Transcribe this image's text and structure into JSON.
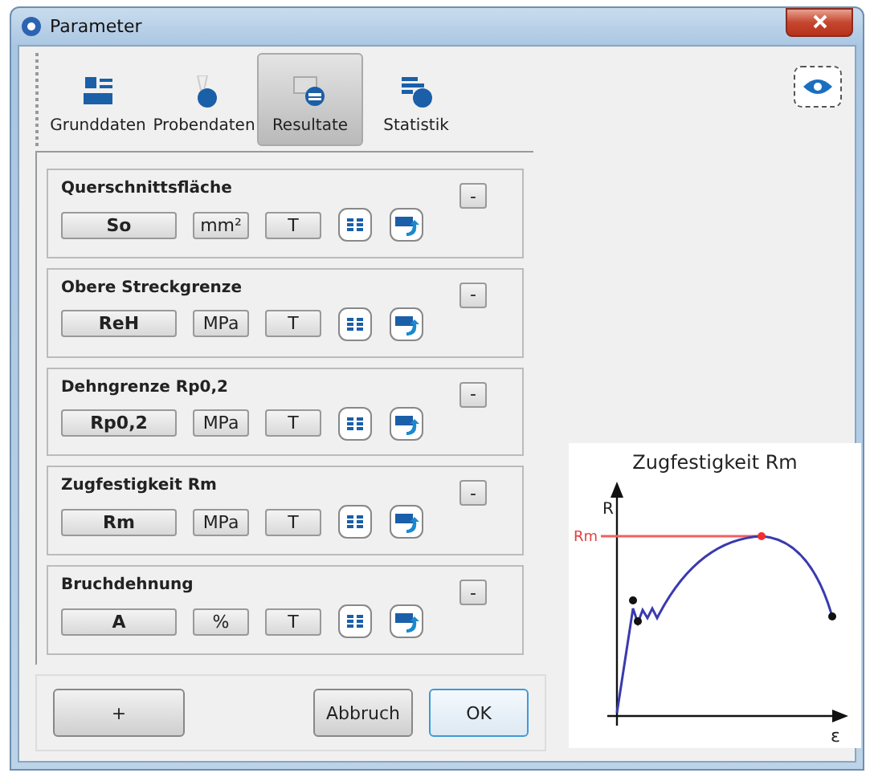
{
  "window": {
    "title": "Parameter"
  },
  "tabs": [
    {
      "label": "Grunddaten",
      "selected": false
    },
    {
      "label": "Probendaten",
      "selected": false
    },
    {
      "label": "Resultate",
      "selected": true
    },
    {
      "label": "Statistik",
      "selected": false
    }
  ],
  "groups": [
    {
      "title": "Querschnittsfläche",
      "symbol": "So",
      "unit": "mm²",
      "type_button": "T",
      "collapse": "-"
    },
    {
      "title": "Obere Streckgrenze",
      "symbol": "ReH",
      "unit": "MPa",
      "type_button": "T",
      "collapse": "-"
    },
    {
      "title": "Dehngrenze Rp0,2",
      "symbol": "Rp0,2",
      "unit": "MPa",
      "type_button": "T",
      "collapse": "-"
    },
    {
      "title": "Zugfestigkeit Rm",
      "symbol": "Rm",
      "unit": "MPa",
      "type_button": "T",
      "collapse": "-"
    },
    {
      "title": "Bruchdehnung",
      "symbol": "A",
      "unit": "%",
      "type_button": "T",
      "collapse": "-"
    }
  ],
  "buttons": {
    "add": "+",
    "cancel": "Abbruch",
    "ok": "OK"
  },
  "diagram": {
    "title": "Zugfestigkeit Rm",
    "y_axis": "R",
    "x_axis": "ε",
    "marker": "Rm"
  }
}
